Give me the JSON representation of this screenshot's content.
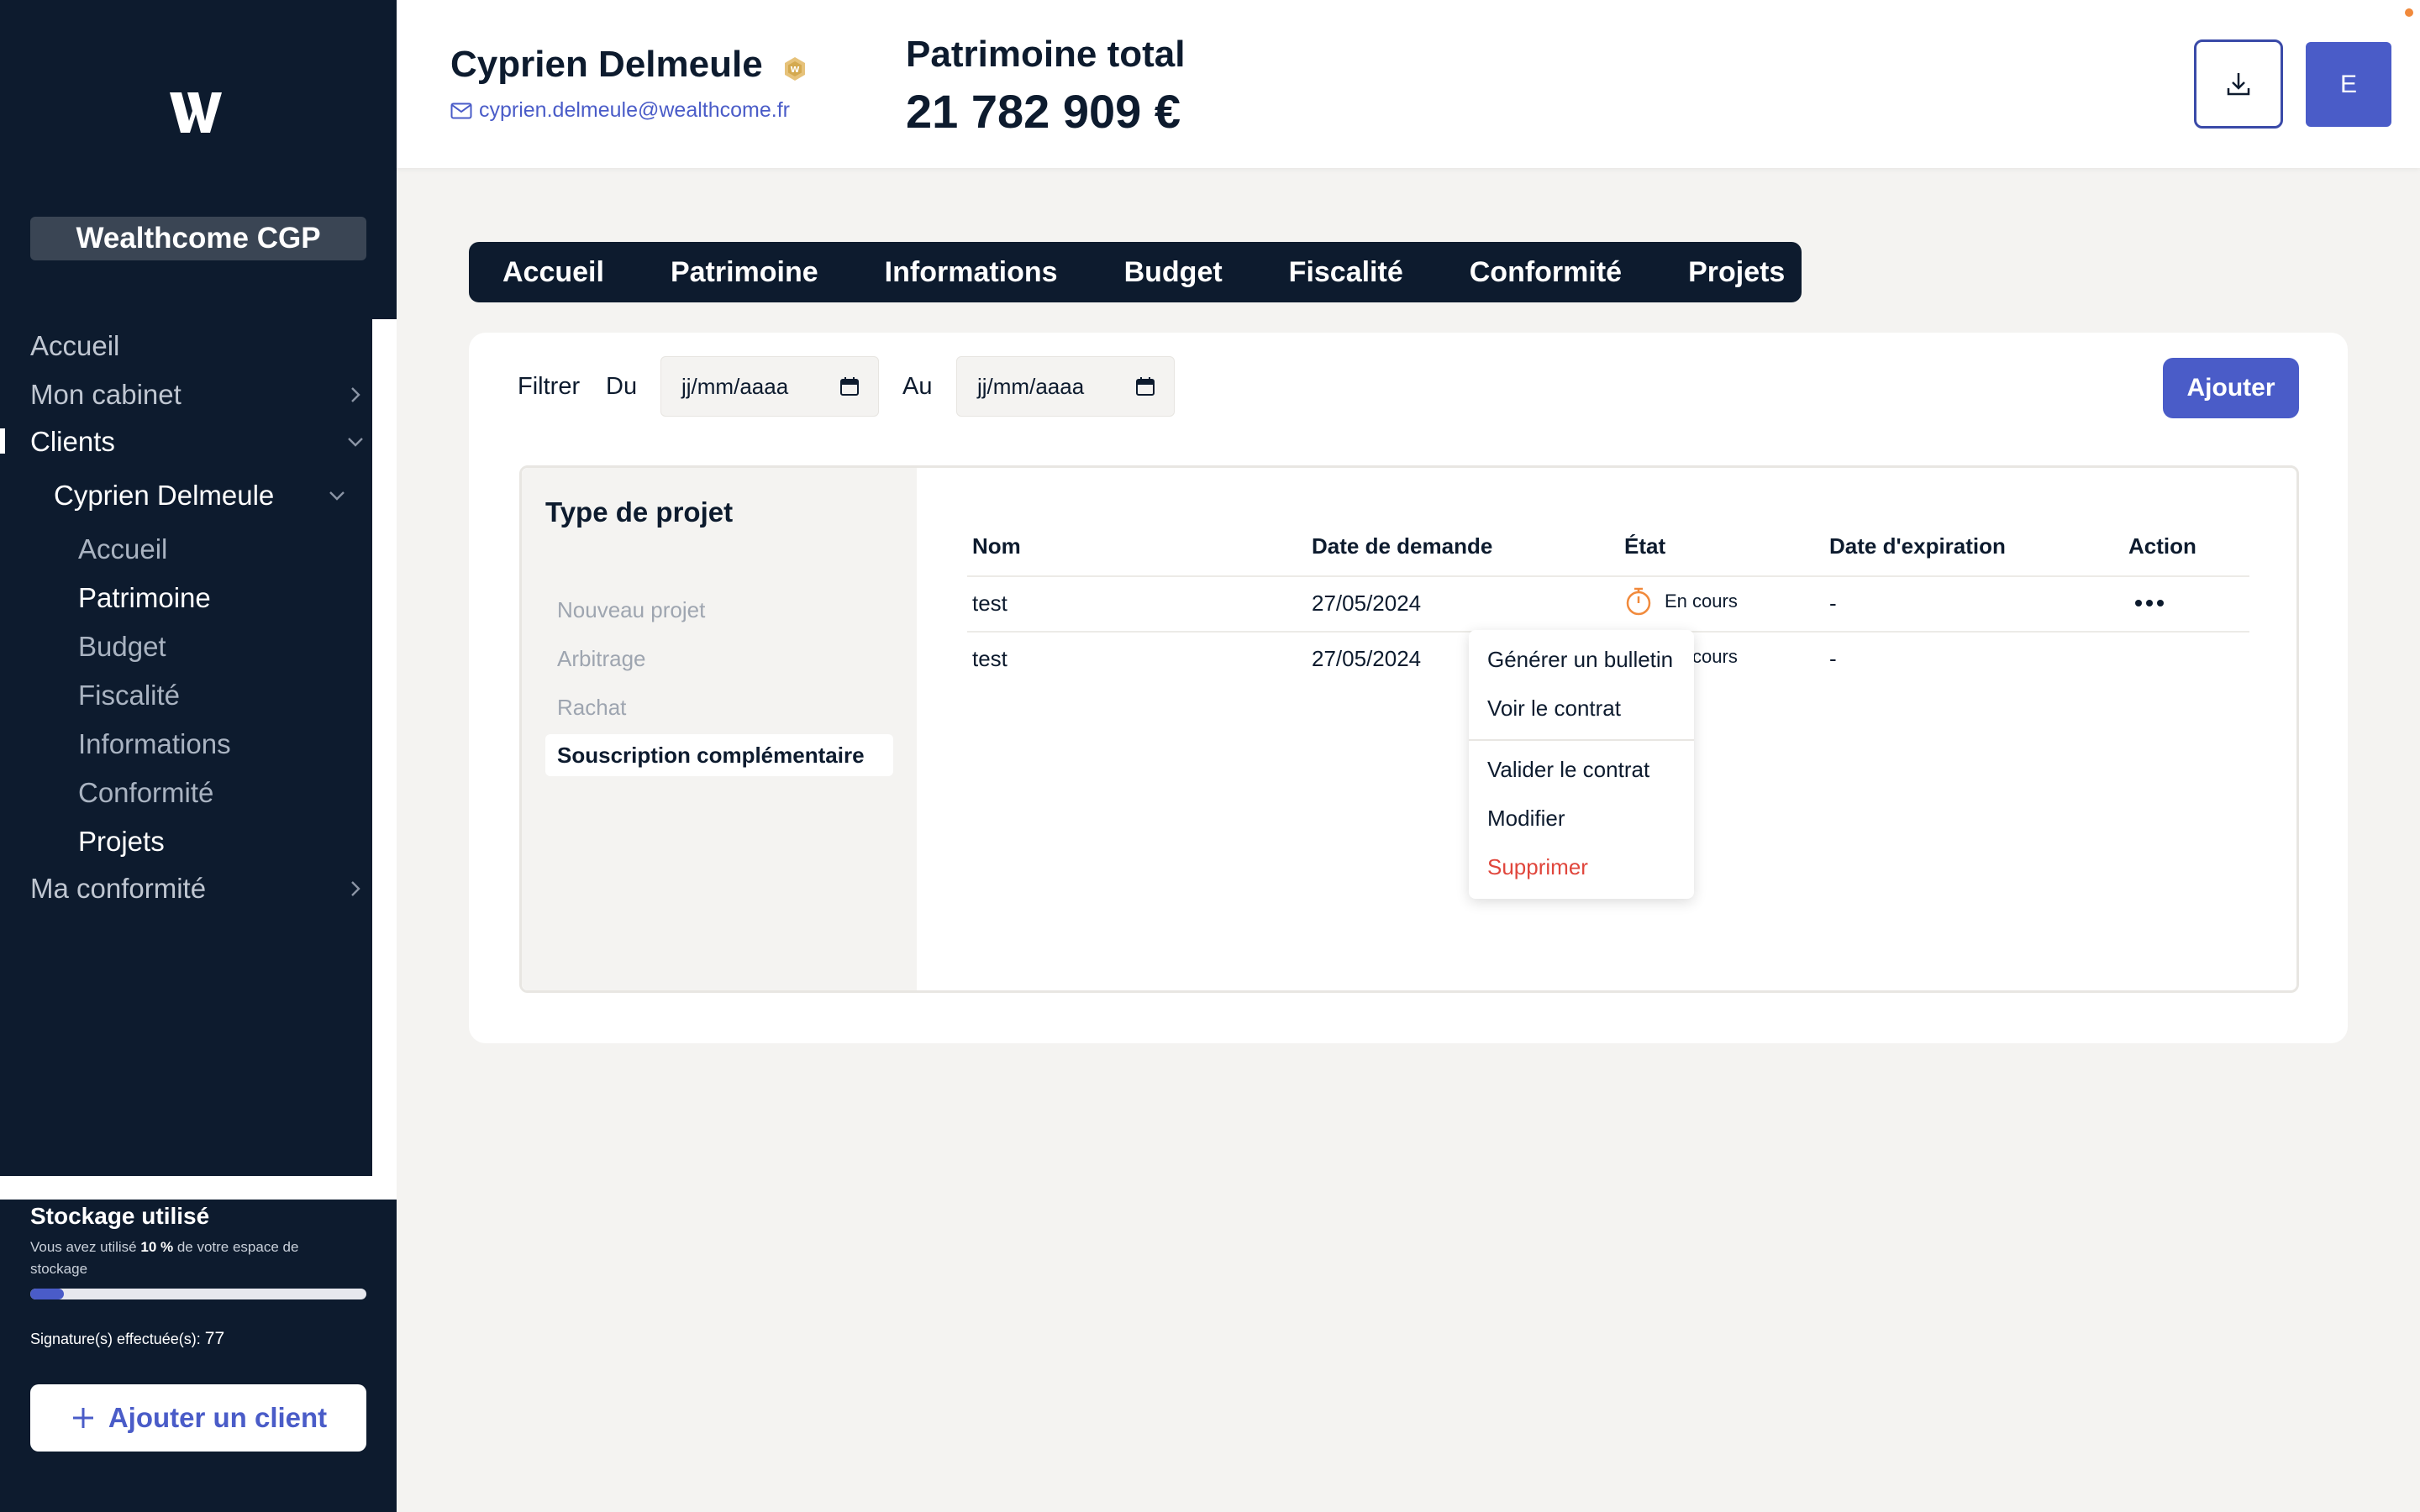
{
  "sidebar": {
    "firm_name": "Wealthcome CGP",
    "nav": {
      "accueil": "Accueil",
      "mon_cabinet": "Mon cabinet",
      "clients": "Clients",
      "client_name": "Cyprien Delmeule",
      "client_sub": [
        "Accueil",
        "Patrimoine",
        "Budget",
        "Fiscalité",
        "Informations",
        "Conformité",
        "Projets"
      ],
      "ma_conformite": "Ma conformité"
    },
    "storage": {
      "title": "Stockage utilisé",
      "text_before": "Vous avez utilisé ",
      "percent": "10 %",
      "text_after": " de votre espace de stockage",
      "used_fraction": 0.1
    },
    "signatures_label": "Signature(s) effectuée(s):",
    "signatures_count": "77",
    "add_client_label": "Ajouter un client",
    "add_client_icon": "plus-icon"
  },
  "header": {
    "client_name": "Cyprien Delmeule",
    "email": "cyprien.delmeule@wealthcome.fr",
    "total_label": "Patrimoine total",
    "total_value": "21 782 909 €",
    "avatar_initial": "E",
    "download_icon": "download-icon"
  },
  "tabs": [
    "Accueil",
    "Patrimoine",
    "Informations",
    "Budget",
    "Fiscalité",
    "Conformité",
    "Projets"
  ],
  "filter": {
    "label": "Filtrer",
    "from_label": "Du",
    "to_label": "Au",
    "from_placeholder": "jj/mm/aaaa",
    "to_placeholder": "jj/mm/aaaa",
    "add_button": "Ajouter"
  },
  "project_types": {
    "title": "Type de projet",
    "items": [
      "Nouveau projet",
      "Arbitrage",
      "Rachat",
      "Souscription complémentaire"
    ],
    "selected": "Souscription complémentaire"
  },
  "table": {
    "headers": [
      "Nom",
      "Date de demande",
      "État",
      "Date d'expiration",
      "Action"
    ],
    "rows": [
      {
        "nom": "test",
        "date": "27/05/2024",
        "etat": "En cours",
        "expiration": "-"
      },
      {
        "nom": "test",
        "date": "27/05/2024",
        "etat": "En cours",
        "expiration": "-"
      }
    ]
  },
  "action_menu": [
    "Générer un bulletin",
    "Voir le contrat",
    "Valider le contrat",
    "Modifier",
    "Supprimer"
  ],
  "colors": {
    "sidebar_bg": "#0d1b2e",
    "accent": "#4a5cc8",
    "status_orange": "#f18a3c",
    "danger": "#e0463c"
  }
}
